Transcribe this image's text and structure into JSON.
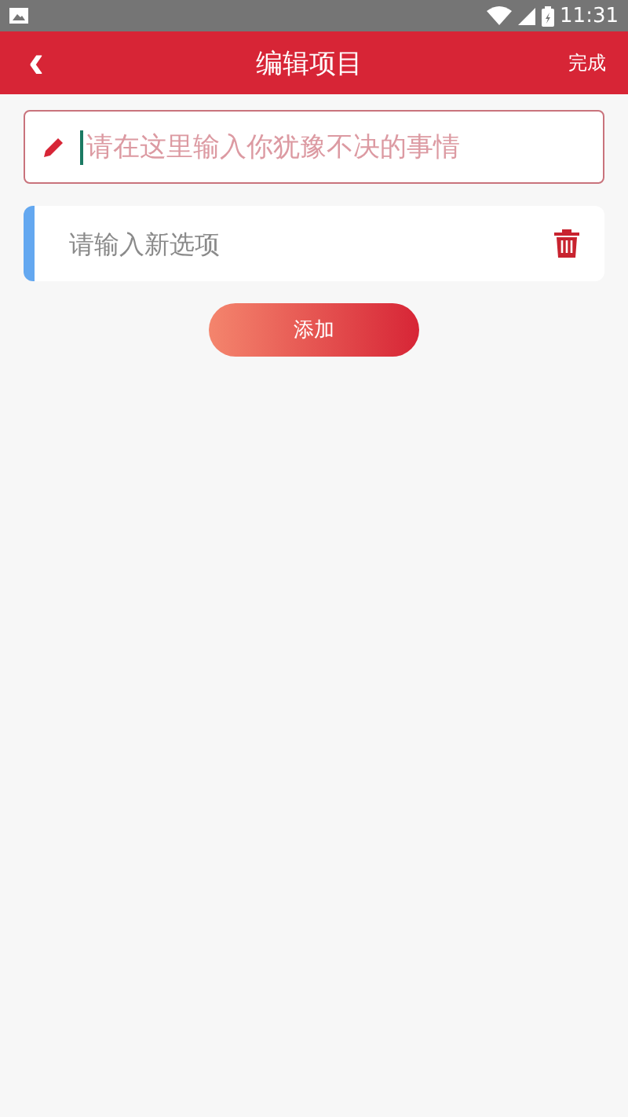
{
  "status_bar": {
    "time": "11:31"
  },
  "header": {
    "back_icon": "‹",
    "title": "编辑项目",
    "action": "完成"
  },
  "question": {
    "placeholder": "请在这里输入你犹豫不决的事情"
  },
  "options": [
    {
      "placeholder": "请输入新选项"
    }
  ],
  "add_button": "添加"
}
